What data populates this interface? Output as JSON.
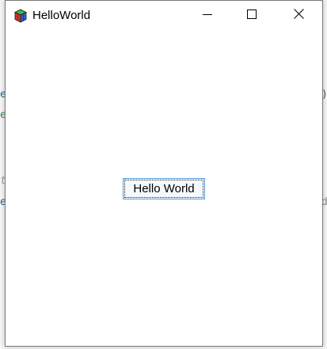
{
  "window": {
    "title": "HelloWorld",
    "controls": {
      "minimize": "minimize-icon",
      "maximize": "maximize-icon",
      "close": "close-icon"
    }
  },
  "client": {
    "button_label": "Hello World"
  },
  "background_fragments": [
    {
      "text": "e",
      "color": "#1d6b8a"
    },
    {
      "text": "e",
      "color": "#2b8a4b"
    },
    {
      "text": "e",
      "color": "#1d6b8a"
    },
    {
      "text": "t",
      "color": "#9a9a9a"
    },
    {
      "text": "d",
      "color": "#8a8a8a"
    },
    {
      "text": ")",
      "color": "#555555"
    }
  ],
  "colors": {
    "button_border": "#5b9bd5",
    "window_border": "#7a7a7a"
  }
}
